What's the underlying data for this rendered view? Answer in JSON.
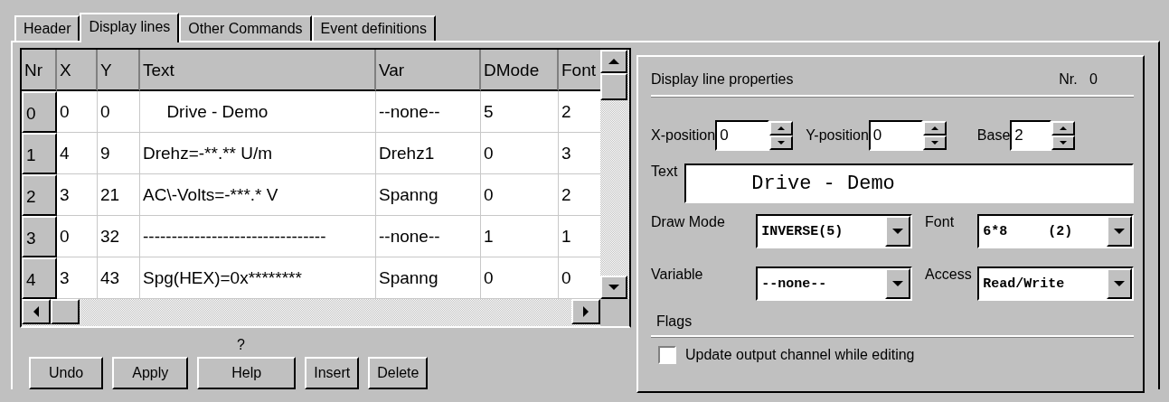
{
  "tabs": [
    {
      "label": "Header",
      "selected": false
    },
    {
      "label": "Display lines",
      "selected": true
    },
    {
      "label": "Other Commands",
      "selected": false
    },
    {
      "label": "Event definitions",
      "selected": false
    }
  ],
  "table": {
    "columns": [
      "Nr",
      "X",
      "Y",
      "Text",
      "Var",
      "DMode",
      "Font"
    ],
    "rows": [
      [
        "0",
        "0",
        "0",
        "     Drive - Demo",
        "--none--",
        "5",
        "2"
      ],
      [
        "1",
        "4",
        "9",
        "Drehz=-**.** U/m",
        "Drehz1",
        "0",
        "3"
      ],
      [
        "2",
        "3",
        "21",
        "AC\\-Volts=-***.* V",
        "Spanng",
        "0",
        "2"
      ],
      [
        "3",
        "0",
        "32",
        "--------------------------------",
        "--none--",
        "1",
        "1"
      ],
      [
        "4",
        "3",
        "43",
        "Spg(HEX)=0x********",
        "Spanng",
        "0",
        "0"
      ]
    ]
  },
  "help_mark": "?",
  "buttons": [
    "Undo",
    "Apply",
    "Help",
    "Insert",
    "Delete"
  ],
  "properties": {
    "title": "Display line properties",
    "nr_label": "Nr.",
    "nr_value": "0",
    "spinners": [
      {
        "label": "X-position",
        "value": "0"
      },
      {
        "label": "Y-position",
        "value": "0"
      },
      {
        "label": "Base",
        "value": "2"
      }
    ],
    "text_label": "Text",
    "text_value": "     Drive - Demo",
    "dropdowns": [
      {
        "label": "Draw Mode",
        "value": "INVERSE(5)"
      },
      {
        "label": "Font",
        "value": "6*8     (2)"
      },
      {
        "label": "Variable",
        "value": "--none--"
      },
      {
        "label": "Access",
        "value": "Read/Write"
      }
    ],
    "flags_title": "Flags",
    "flags": [
      {
        "label": "Update output channel while editing",
        "checked": false
      }
    ]
  }
}
